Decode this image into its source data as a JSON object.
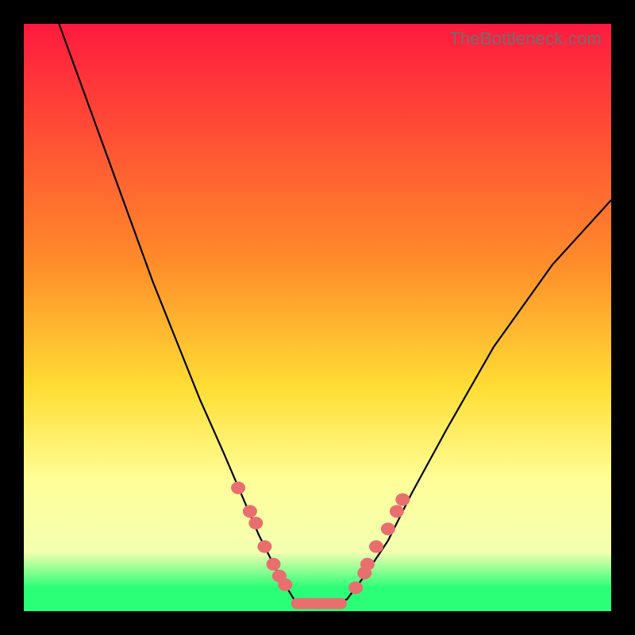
{
  "watermark": "TheBottleneck.com",
  "colors": {
    "top": "#ff1a3f",
    "orange": "#ff8a2a",
    "yellow": "#ffde35",
    "pale": "#ffff9a",
    "pale2": "#f3ffb0",
    "green": "#2bff77",
    "dot": "#e96f6f"
  },
  "chart_data": {
    "type": "line",
    "title": "",
    "xlabel": "",
    "ylabel": "",
    "xlim": [
      0,
      100
    ],
    "ylim": [
      0,
      100
    ],
    "grid": false,
    "legend": false,
    "note": "Axes unlabeled in source image; x maps left→right 0–100, y maps bottom→top 0–100. Curve is a V-shaped bottleneck profile with flat minimum near zero around x≈46–55.",
    "series": [
      {
        "name": "curve",
        "x": [
          6,
          10,
          14,
          18,
          22,
          26,
          30,
          34,
          37,
          40,
          43,
          46,
          48,
          50,
          52,
          55,
          58,
          62,
          66,
          72,
          80,
          90,
          100
        ],
        "y": [
          100,
          89,
          78,
          67,
          56,
          46,
          36,
          27,
          20,
          13,
          7,
          2,
          1,
          0.5,
          1,
          2,
          6,
          12,
          20,
          31,
          45,
          59,
          70
        ]
      }
    ],
    "markers": {
      "name": "highlight-dots",
      "note": "Salmon dots clustered on both flanks near the minimum and a ridge along the flat bottom.",
      "x": [
        36.5,
        38.5,
        39.5,
        41,
        42.5,
        43.5,
        44.5,
        56.5,
        58,
        58.5,
        60,
        62,
        63.5,
        64.5
      ],
      "y": [
        21,
        17,
        15,
        11,
        8,
        6,
        4.5,
        4,
        6.5,
        8,
        11,
        14,
        17,
        19
      ],
      "flat_bottom": {
        "x0": 45.5,
        "x1": 55.0,
        "y": 1.3
      }
    }
  }
}
